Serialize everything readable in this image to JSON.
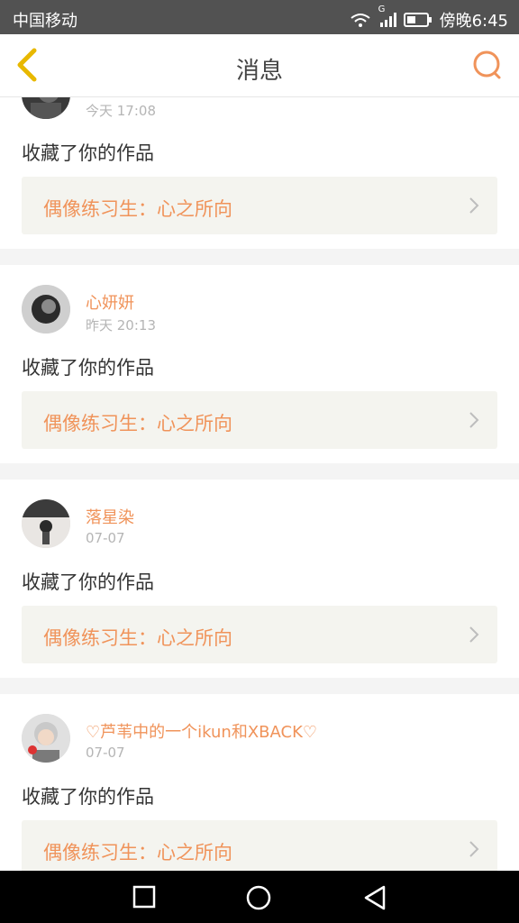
{
  "statusbar": {
    "carrier": "中国移动",
    "network_label": "G",
    "time": "傍晚6:45"
  },
  "header": {
    "title": "消息",
    "back_icon": "chevron-left-icon",
    "search_icon": "search-icon",
    "accent_color": "#f0935a"
  },
  "messages": [
    {
      "username": "",
      "time": "今天 17:08",
      "action": "收藏了你的作品",
      "work_title": "偶像练习生：心之所向"
    },
    {
      "username": "心妍妍",
      "time": "昨天 20:13",
      "action": "收藏了你的作品",
      "work_title": "偶像练习生：心之所向"
    },
    {
      "username": "落星染",
      "time": "07-07",
      "action": "收藏了你的作品",
      "work_title": "偶像练习生：心之所向"
    },
    {
      "username": "♡芦苇中的一个ikun和XBACK♡",
      "time": "07-07",
      "action": "收藏了你的作品",
      "work_title": "偶像练习生：心之所向"
    }
  ],
  "navbar": {
    "icons": [
      "square-icon",
      "circle-home-icon",
      "triangle-back-icon"
    ]
  }
}
